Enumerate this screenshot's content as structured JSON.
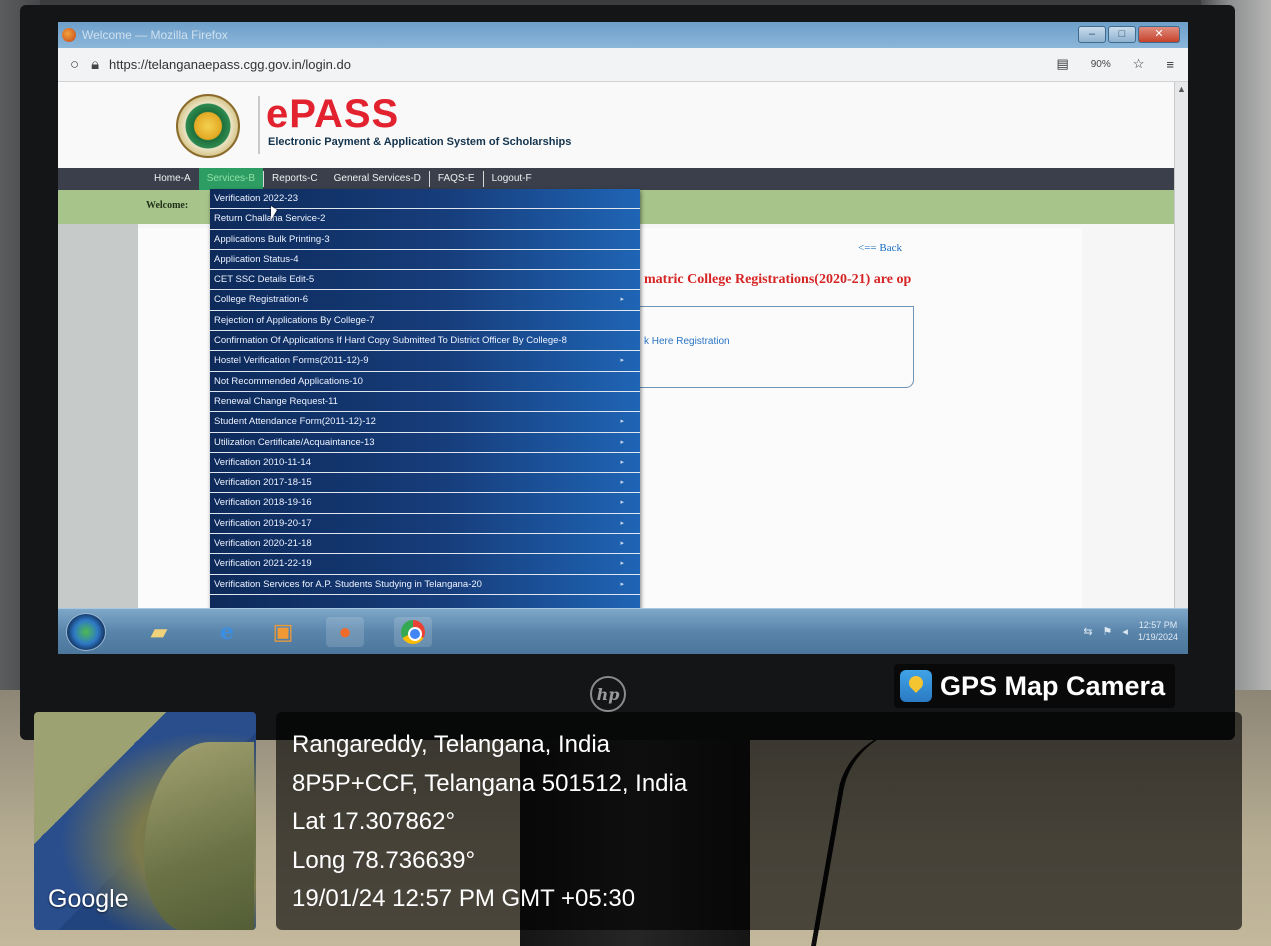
{
  "browser": {
    "window_title": "Welcome — Mozilla Firefox",
    "url": "https://telanganaepass.cgg.gov.in/login.do",
    "zoom": "90%"
  },
  "site": {
    "logo_text": "ePASS",
    "tagline": "Electronic Payment & Application System of Scholarships"
  },
  "menu": {
    "items": [
      "Home-A",
      "Services-B",
      "Reports-C",
      "General Services-D",
      "FAQS-E",
      "Logout-F"
    ]
  },
  "welcome_label": "Welcome:",
  "content": {
    "back_link": "<== Back",
    "notice": "matric College Registrations(2020-21) are op",
    "registration_link": "k Here Registration"
  },
  "dropdown": {
    "items": [
      "Verification 2022-23",
      "Return Challana Service-2",
      "Applications Bulk Printing-3",
      "Application Status-4",
      "CET SSC Details Edit-5",
      "College Registration-6",
      "Rejection of Applications By College-7",
      "Confirmation Of Applications If Hard Copy Submitted To District Officer By College-8",
      "Hostel Verification Forms(2011-12)-9",
      "Not Recommended Applications-10",
      "Renewal Change Request-11",
      "Student Attendance Form(2011-12)-12",
      "Utilization Certificate/Acquaintance-13",
      "Verification 2010-11-14",
      "Verification 2017-18-15",
      "Verification 2018-19-16",
      "Verification 2019-20-17",
      "Verification 2020-21-18",
      "Verification 2021-22-19",
      "Verification Services for A.P. Students Studying in Telangana-20"
    ]
  },
  "taskbar": {
    "time": "12:57 PM",
    "date": "1/19/2024"
  },
  "overlay": {
    "app_name": "GPS Map Camera",
    "map_label": "Google",
    "location": "Rangareddy, Telangana, India",
    "address": "8P5P+CCF, Telangana 501512, India",
    "lat": "Lat 17.307862°",
    "long": "Long 78.736639°",
    "datetime": "19/01/24 12:57 PM GMT +05:30"
  },
  "hp_logo": "hp"
}
